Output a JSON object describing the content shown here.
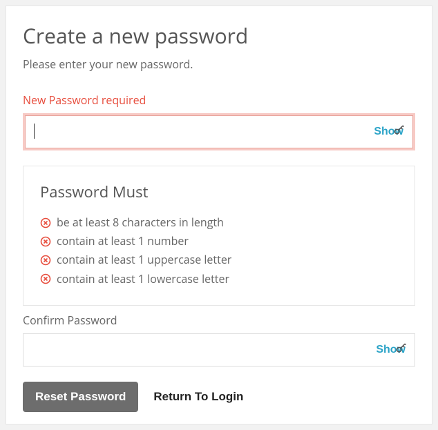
{
  "title": "Create a new password",
  "subtitle": "Please enter your new password.",
  "newPassword": {
    "label": "New Password required",
    "value": "",
    "showLabel": "Show"
  },
  "rules": {
    "title": "Password Must",
    "items": [
      "be at least 8 characters in length",
      "contain at least 1 number",
      "contain at least 1 uppercase letter",
      "contain at least 1 lowercase letter"
    ]
  },
  "confirmPassword": {
    "label": "Confirm Password",
    "value": "",
    "showLabel": "Show"
  },
  "actions": {
    "reset": "Reset Password",
    "return": "Return To Login"
  },
  "colors": {
    "error": "#e74c3c",
    "link": "#2aa3c7"
  }
}
